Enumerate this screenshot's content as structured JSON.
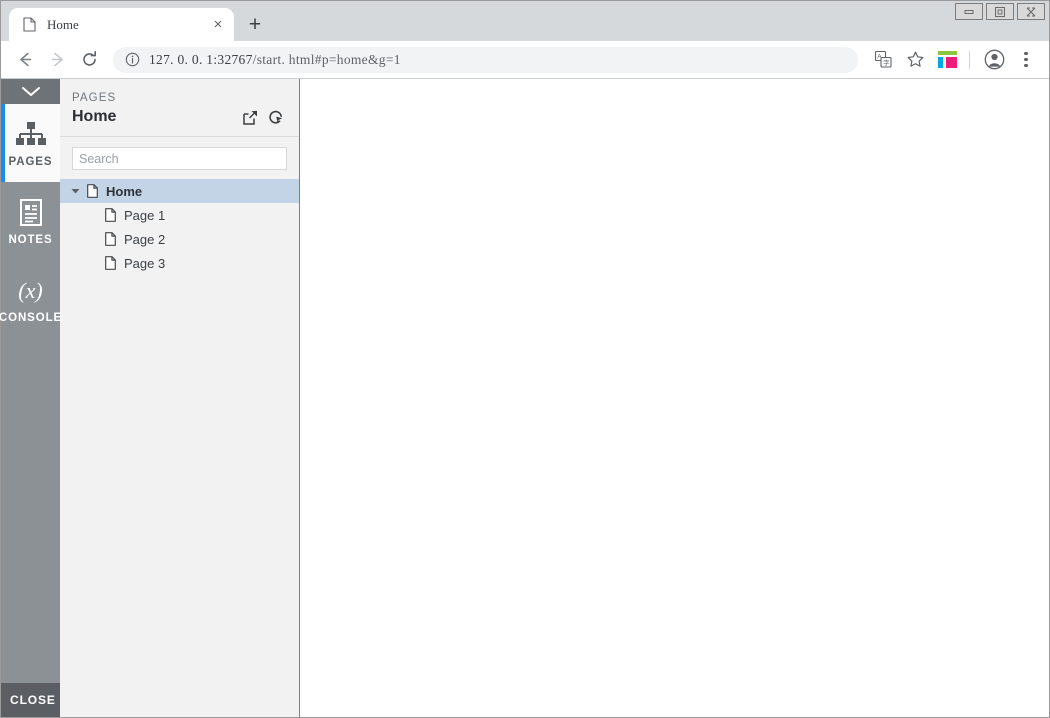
{
  "window": {
    "controls": [
      {
        "name": "minimize",
        "glyph": "minimize"
      },
      {
        "name": "restore",
        "glyph": "restore"
      },
      {
        "name": "close",
        "glyph": "close"
      }
    ]
  },
  "tabstrip": {
    "tab": {
      "title": "Home",
      "favicon": "page-icon",
      "close_label": "×"
    },
    "new_tab_label": "+"
  },
  "toolbar": {
    "back_icon": "arrow-left-icon",
    "forward_icon": "arrow-right-icon",
    "reload_icon": "reload-icon",
    "omnibox": {
      "info_icon": "info-circle-icon",
      "host": "127. 0. 0. 1:32767",
      "path": "/start. html",
      "fragment": "#p=home&g=1",
      "full_url": "127. 0. 0. 1:32767/start. html#p=home&g=1"
    },
    "translate_icon": "translate-icon",
    "bookmark_icon": "star-icon",
    "extension_icon": "extension-icon",
    "profile_icon": "profile-avatar-icon",
    "menu_icon": "three-dot-menu-icon",
    "extension_colors": {
      "top": "#8cc63f",
      "left": "#00a8e1",
      "right": "#ec1e79"
    }
  },
  "rail": {
    "collapse_icon": "chevron-down-icon",
    "items": [
      {
        "label": "PAGES",
        "icon": "sitemap-icon",
        "active": true
      },
      {
        "label": "NOTES",
        "icon": "notes-document-icon",
        "active": false
      },
      {
        "label": "CONSOLE",
        "icon": "(x)",
        "active": false
      }
    ],
    "close_label": "CLOSE",
    "accent_color": "#1a8cf0"
  },
  "panel": {
    "kicker": "PAGES",
    "title": "Home",
    "actions": [
      {
        "name": "open-external-icon",
        "icon": "open-in-new-icon"
      },
      {
        "name": "reload-panel-icon",
        "icon": "refresh-circle-icon"
      }
    ],
    "search": {
      "placeholder": "Search",
      "value": ""
    },
    "tree": [
      {
        "label": "Home",
        "level": 0,
        "selected": true,
        "expanded": true,
        "icon": "page-icon"
      },
      {
        "label": "Page 1",
        "level": 1,
        "selected": false,
        "icon": "page-icon"
      },
      {
        "label": "Page 2",
        "level": 1,
        "selected": false,
        "icon": "page-icon"
      },
      {
        "label": "Page 3",
        "level": 1,
        "selected": false,
        "icon": "page-icon"
      }
    ],
    "selected_color": "#c2d4e6"
  },
  "content": {
    "body": ""
  }
}
